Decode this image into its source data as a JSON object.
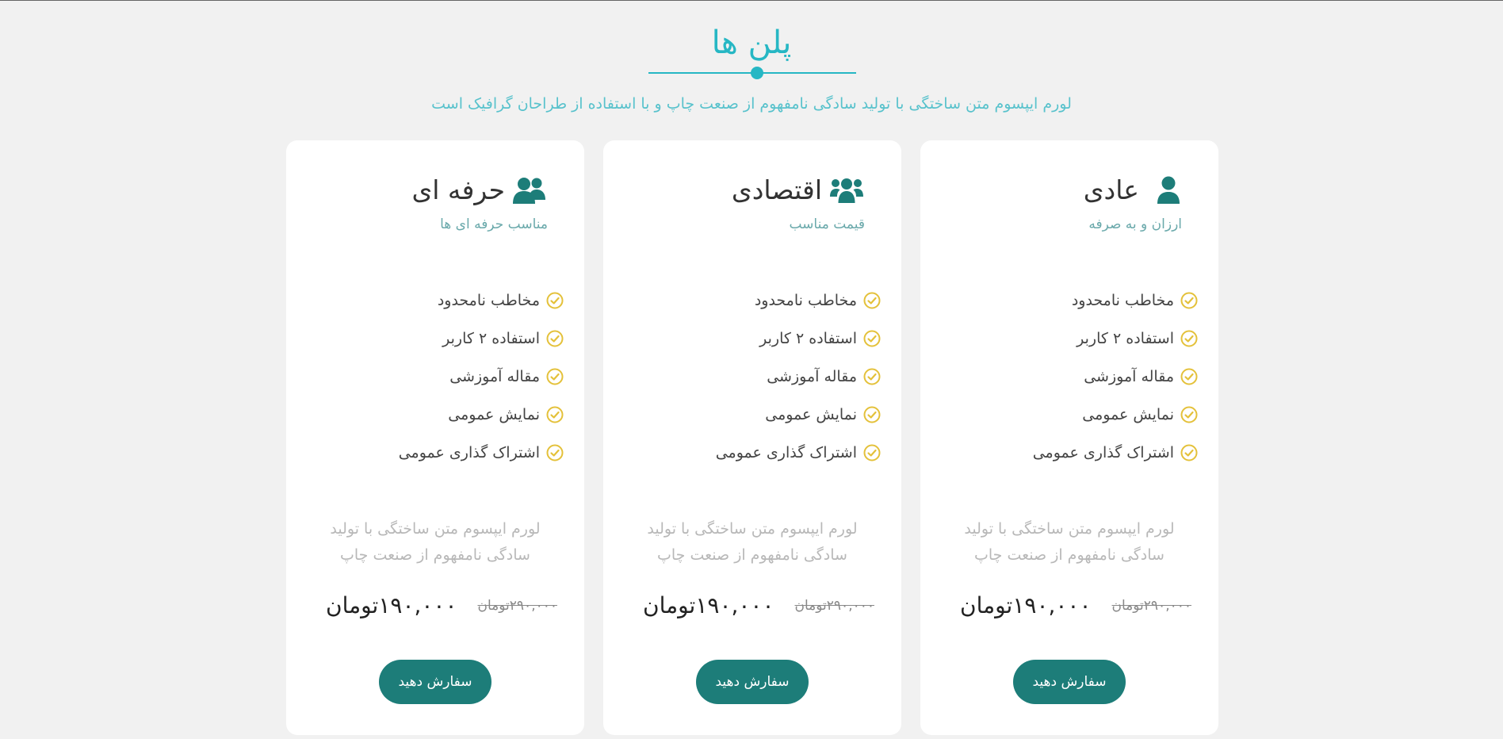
{
  "header": {
    "title": "پلن ها",
    "subtitle": "لورم ایپسوم متن ساختگی با تولید سادگی نامفهوم از صنعت چاپ و با استفاده از طراحان گرافیک است"
  },
  "colors": {
    "accent": "#26b7c4",
    "brand": "#1d7d79",
    "check": "#e4c13a"
  },
  "plans": [
    {
      "icon": "user-icon",
      "title": "عادی",
      "subtitle": "ارزان و به صرفه",
      "features": [
        "مخاطب نامحدود",
        "استفاده ۲ کاربر",
        "مقاله آموزشی",
        "نمایش عمومی",
        "اشتراک گذاری عمومی"
      ],
      "description": "لورم ایپسوم متن ساختگی با تولید سادگی نامفهوم از صنعت چاپ",
      "old_price": "۲۹۰,۰۰۰تومان",
      "new_price": "۱۹۰,۰۰۰تومان",
      "button": "سفارش دهید"
    },
    {
      "icon": "users-group-icon",
      "title": "اقتصادی",
      "subtitle": "قیمت مناسب",
      "features": [
        "مخاطب نامحدود",
        "استفاده ۲ کاربر",
        "مقاله آموزشی",
        "نمایش عمومی",
        "اشتراک گذاری عمومی"
      ],
      "description": "لورم ایپسوم متن ساختگی با تولید سادگی نامفهوم از صنعت چاپ",
      "old_price": "۲۹۰,۰۰۰تومان",
      "new_price": "۱۹۰,۰۰۰تومان",
      "button": "سفارش دهید"
    },
    {
      "icon": "user-friends-icon",
      "title": "حرفه ای",
      "subtitle": "مناسب حرفه ای ها",
      "features": [
        "مخاطب نامحدود",
        "استفاده ۲ کاربر",
        "مقاله آموزشی",
        "نمایش عمومی",
        "اشتراک گذاری عمومی"
      ],
      "description": "لورم ایپسوم متن ساختگی با تولید سادگی نامفهوم از صنعت چاپ",
      "old_price": "۲۹۰,۰۰۰تومان",
      "new_price": "۱۹۰,۰۰۰تومان",
      "button": "سفارش دهید"
    }
  ]
}
